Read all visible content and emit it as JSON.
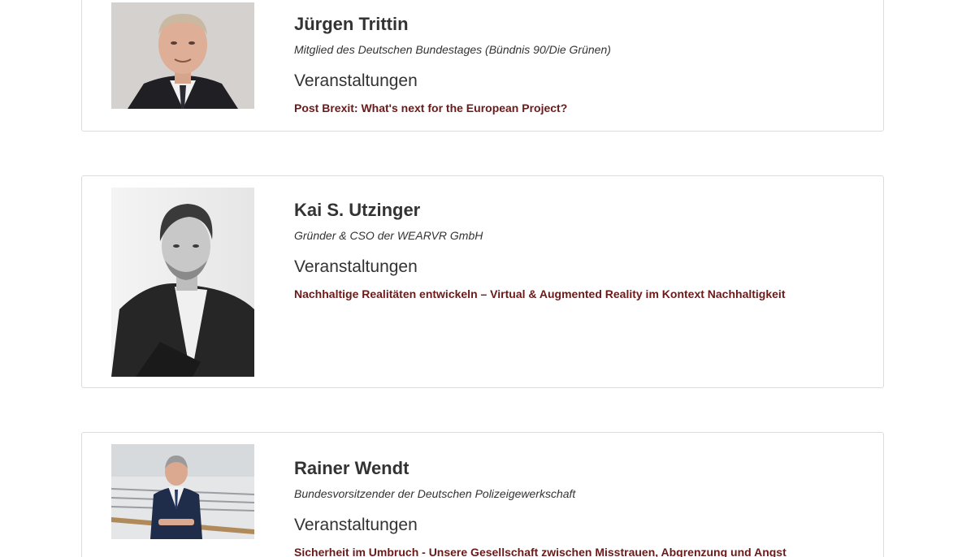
{
  "speakers": [
    {
      "name": "Jürgen Trittin",
      "role": "Mitglied des Deutschen Bundestages (Bündnis 90/Die Grünen)",
      "section_title": "Veranstaltungen",
      "events": [
        "Post Brexit: What's next for the European Project?"
      ]
    },
    {
      "name": "Kai S. Utzinger",
      "role": "Gründer & CSO der WEARVR GmbH",
      "section_title": "Veranstaltungen",
      "events": [
        "Nachhaltige Realitäten entwickeln – Virtual & Augmented Reality im Kontext Nachhaltigkeit"
      ]
    },
    {
      "name": "Rainer Wendt",
      "role": "Bundesvorsitzender der Deutschen Polizeigewerkschaft",
      "section_title": "Veranstaltungen",
      "events": [
        "Sicherheit im Umbruch - Unsere Gesellschaft zwischen Misstrauen, Abgrenzung und Angst"
      ]
    }
  ],
  "colors": {
    "event_link": "#6b1a1a",
    "text": "#333333",
    "card_border": "#dcdcdc"
  }
}
